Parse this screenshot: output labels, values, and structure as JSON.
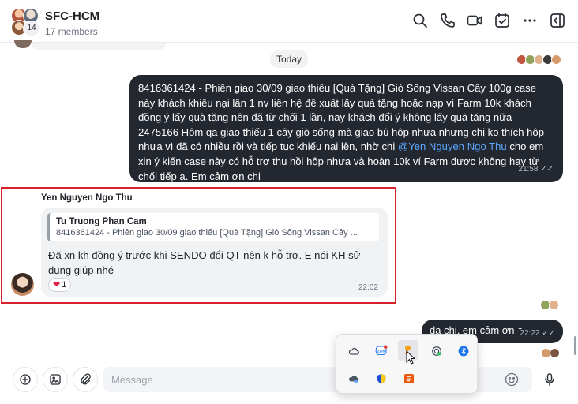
{
  "header": {
    "title": "SFC-HCM",
    "members": "17 members",
    "avatar_count": "14"
  },
  "chat": {
    "date_divider": "Today",
    "outgoing_long": {
      "text_before_mention": "8416361424 - Phiên giao 30/09 giao thiếu  [Quà Tặng] Giò Sống Vissan Cây 100g case này khách khiếu nại lần 1 nv liên hệ đề xuất lấy quà tặng hoặc nạp ví Farm 10k khách đồng ý lấy quà tặng nên đã từ chối 1 lần, nay khách đổi ý không lấy quà tặng nữa 2475166 Hôm qa giao thiếu 1 cây giò sống mà giao bù hộp nhựa nhưng chị ko thích hộp nhựa vì đã có nhiều rồi và tiếp tục khiếu nại lên, nhờ chị ",
      "mention": "@Yen Nguyen Ngo Thu",
      "text_after_mention": " cho em xin ý kiến case này có hỗ trợ thu hồi hộp nhựa và hoàn 10k ví Farm được không hay từ chối tiếp ạ. Em cảm ơn chị",
      "time": "21:58"
    },
    "incoming": {
      "sender": "Yen Nguyen Ngo Thu",
      "reply_name": "Tu Truong Phan Cam",
      "reply_text": "8416361424 - Phiên giao 30/09 giao thiếu [Quà Tặng] Giò Sống Vissan Cây ...",
      "text": "Đã xn kh đồng ý trước khi SENDO đổi QT nên k hỗ trợ. E nói KH sử dụng giúp nhé",
      "reaction_count": "1",
      "time": "22:02"
    },
    "outgoing_short": {
      "text": "da chị, em cảm ơn ạ",
      "time": "22:22"
    }
  },
  "input": {
    "placeholder": "Message"
  },
  "colors": {
    "outgoing_bubble": "#23272f",
    "incoming_bubble": "#f1f2f4",
    "mention": "#5aa8ff",
    "selection_frame": "#d6202a"
  },
  "tray_icons": [
    "onedrive-icon",
    "zalo-icon",
    "app-orange-icon",
    "network-icon",
    "bluetooth-icon",
    "cloud-sync-icon",
    "security-shield-icon",
    "app-tile-icon"
  ]
}
